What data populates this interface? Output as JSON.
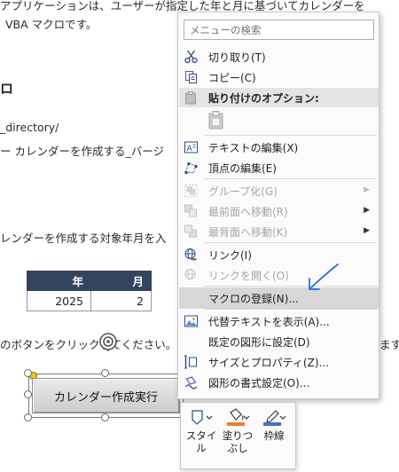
{
  "document": {
    "line1": "アプリケーションは、ユーザーが指定した年と月に基づいてカレンダーを",
    "line2": "VBA マクロです。",
    "heading": "ロ",
    "path": "_directory/",
    "file_line": "ー カレンダーを作成する_バージ",
    "target_line": "レンダーを作成する対象年月を入",
    "table": {
      "headers": [
        "年",
        "月"
      ],
      "values": [
        "2025",
        "2"
      ]
    },
    "instruction": "のボタンをクリックしてください。",
    "instruction_tail": "ます。",
    "macro_button_label": "カレンダー作成実行"
  },
  "context_menu": {
    "search_placeholder": "メニューの検索",
    "items": [
      {
        "label": "切り取り(T)",
        "icon": "scissors-icon"
      },
      {
        "label": "コピー(C)",
        "icon": "copy-icon"
      },
      {
        "label": "貼り付けのオプション:",
        "icon": "paste-icon"
      },
      {
        "label": "",
        "icon": "clipboard-icon"
      },
      {
        "label": "テキストの編集(X)",
        "icon": "text-edit-icon"
      },
      {
        "label": "頂点の編集(E)",
        "icon": "edit-points-icon"
      },
      {
        "label": "グループ化(G)",
        "icon": "group-icon"
      },
      {
        "label": "最前面へ移動(R)",
        "icon": "bring-to-front-icon"
      },
      {
        "label": "最背面へ移動(K)",
        "icon": "send-to-back-icon"
      },
      {
        "label": "リンク(I)",
        "icon": "link-icon"
      },
      {
        "label": "リンクを開く(O)",
        "icon": "open-link-icon"
      },
      {
        "label": "マクロの登録(N)...",
        "icon": ""
      },
      {
        "label": "代替テキストを表示(A)...",
        "icon": "alt-text-icon"
      },
      {
        "label": "既定の図形に設定(D)",
        "icon": ""
      },
      {
        "label": "サイズとプロパティ(Z)...",
        "icon": "size-properties-icon"
      },
      {
        "label": "図形の書式設定(O)...",
        "icon": "format-shape-icon"
      }
    ]
  },
  "mini_toolbar": {
    "style_label": "スタイル",
    "fill_label": "塗りつぶし",
    "outline_label": "枠線"
  },
  "colors": {
    "table_header": "#34445e",
    "menu_highlight": "#d7d7d7",
    "annotation_arrow": "#2a6fd6",
    "fill_orange": "#ed7d31",
    "outline_blue": "#4472c4"
  }
}
